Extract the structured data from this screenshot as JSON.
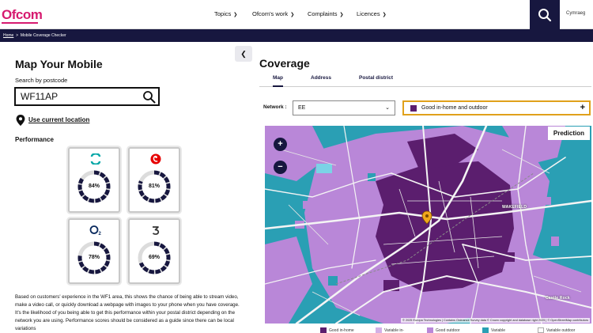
{
  "header": {
    "logo": "Ofcom",
    "nav": [
      "Topics",
      "Ofcom's work",
      "Complaints",
      "Licences"
    ],
    "language": "Cymraeg"
  },
  "breadcrumb": [
    "Home",
    "Mobile Coverage Checker"
  ],
  "left": {
    "title": "Map Your Mobile",
    "search_label": "Search by postcode",
    "postcode": "WF11AP",
    "location_link": "Use current location",
    "performance_label": "Performance",
    "operators": [
      {
        "name": "EE",
        "pct": "84%",
        "value": 84,
        "color": "#00a6a6"
      },
      {
        "name": "Vodafone",
        "pct": "81%",
        "value": 81,
        "color": "#e60000"
      },
      {
        "name": "O2",
        "pct": "78%",
        "value": 78,
        "color": "#0a2a5e"
      },
      {
        "name": "Three",
        "pct": "69%",
        "value": 69,
        "color": "#333333"
      }
    ],
    "description": "Based on customers' experience in the WF1 area, this shows the chance of being able to stream video, make a video call, or quickly download a webpage with images to your phone when you have coverage. It's the likelihood of you being able to get this performance within your postal district depending on the network you are using. Performance scores should be considered as a guide since there can be local variations"
  },
  "right": {
    "title": "Coverage",
    "tabs": [
      "Map",
      "Address",
      "Postal district"
    ],
    "network_label": "Network :",
    "network_value": "EE",
    "filter_value": "Good in-home and outdoor",
    "prediction_label": "Prediction",
    "attribution": "© 2025 Europa Technologies | Contains Ordnance Survey data © Crown copyright and database right 2025 | © OpenStreetMap contributors",
    "places": [
      "WAKEFIELD",
      "Castle Rock"
    ],
    "legend": [
      "Good in-home",
      "Variable in-",
      "Good outdoor",
      "Variable",
      "Variable outdoor"
    ]
  },
  "colors": {
    "navy": "#17173f",
    "brand": "#d61a6f",
    "good_indoor": "#5b1e6e",
    "good_outdoor": "#b987d8",
    "variable": "#2a9fb4",
    "accent": "#e0a11b"
  }
}
